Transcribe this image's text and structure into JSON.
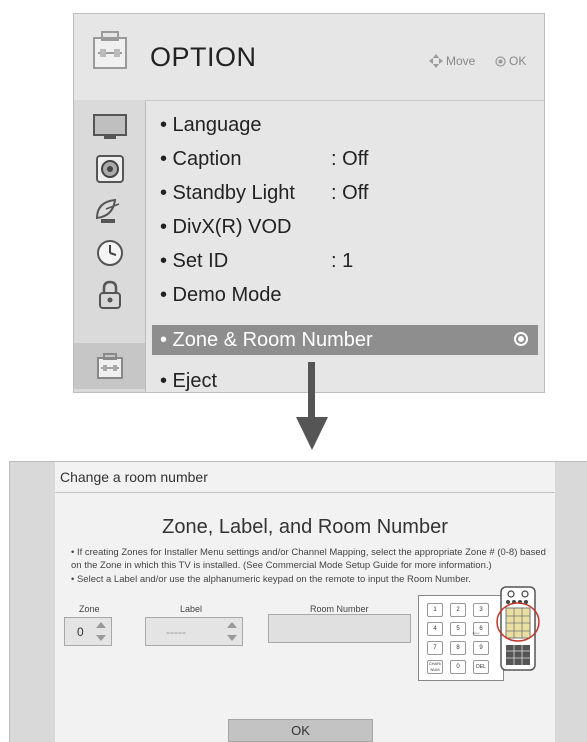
{
  "menu": {
    "title": "OPTION",
    "hints": {
      "move": "Move",
      "ok": "OK"
    },
    "tabs": [
      {
        "icon": "picture-icon"
      },
      {
        "icon": "audio-icon"
      },
      {
        "icon": "satellite-icon"
      },
      {
        "icon": "clock-icon"
      },
      {
        "icon": "lock-icon"
      },
      {
        "icon": "option-icon",
        "active": true
      }
    ],
    "items": [
      {
        "label": "• Language",
        "value": ""
      },
      {
        "label": "• Caption",
        "value": ": Off"
      },
      {
        "label": "• Standby Light",
        "value": ": Off"
      },
      {
        "label": "• DivX(R) VOD",
        "value": ""
      },
      {
        "label": "• Set ID",
        "value": ": 1"
      },
      {
        "label": "• Demo Mode",
        "value": ""
      },
      {
        "label": "• Zone & Room Number",
        "value": "",
        "selected": true
      },
      {
        "label": "• Eject",
        "value": ""
      }
    ]
  },
  "dialog": {
    "header": "Change a room number",
    "title": "Zone, Label, and Room Number",
    "notes": [
      "• If creating Zones for Installer Menu settings and/or Channel Mapping, select the appropriate Zone # (0-8) based on the Zone in which this TV is installed. (See Commercial Mode Setup Guide for more information.)",
      "• Select a Label and/or use the alphanumeric keypad on the remote to input the Room Number."
    ],
    "zone": {
      "label": "Zone",
      "value": "0"
    },
    "label_field": {
      "label": "Label",
      "value": "-----"
    },
    "room": {
      "label": "Room Number",
      "value": ""
    },
    "keypad": [
      "1",
      "2",
      "3",
      "4",
      "5",
      "6",
      "7",
      "8",
      "9",
      "CHAR/ NUM",
      "0",
      "DEL"
    ],
    "ok_label": "OK"
  },
  "colors": {
    "menu_bg": "#e6e6e6",
    "selected_bg": "#8e8e8e",
    "dialog_bg": "#f2f2f2"
  }
}
